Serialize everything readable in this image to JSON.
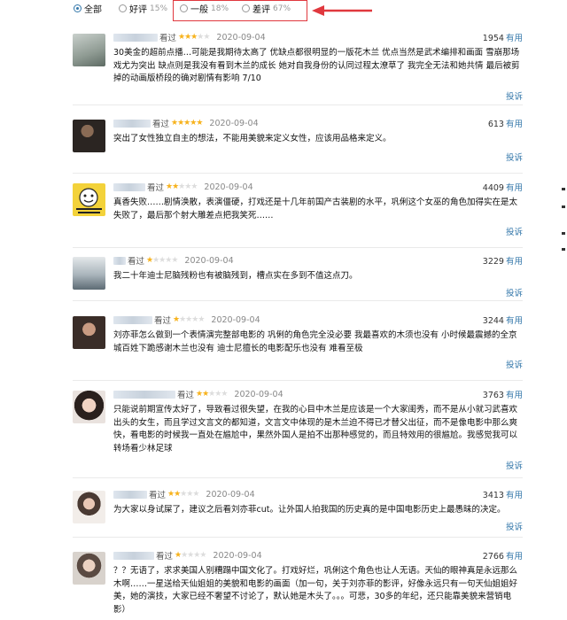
{
  "filters": {
    "options": [
      {
        "label": "全部",
        "pct": "",
        "selected": true
      },
      {
        "label": "好评",
        "pct": "15%",
        "selected": false
      },
      {
        "label": "一般",
        "pct": "18%",
        "selected": false
      },
      {
        "label": "差评",
        "pct": "67%",
        "selected": false
      }
    ],
    "highlight_color": "#e0383e"
  },
  "colors": {
    "accent": "#3377aa",
    "star": "#f7b21c"
  },
  "comments": [
    {
      "watched": "看过",
      "stars": 3,
      "date": "2020-09-04",
      "votes": "1954",
      "useful": "有用",
      "report": "投诉",
      "text": "30美金的超前点播…可能是我期待太高了 优缺点都很明显的一版花木兰 优点当然是武术编排和画面 雪崩那场戏尤为突出 缺点则是我没有看到木兰的成长 她对自我身份的认同过程太潦草了 我完全无法和她共情 最后被剪掉的动画版桥段的确对剧情有影响 7/10"
    },
    {
      "watched": "看过",
      "stars": 5,
      "date": "2020-09-04",
      "votes": "613",
      "useful": "有用",
      "report": "投诉",
      "text": "突出了女性独立自主的想法，不能用美貌来定义女性，应该用品格来定义。"
    },
    {
      "watched": "看过",
      "stars": 2,
      "date": "2020-09-04",
      "votes": "4409",
      "useful": "有用",
      "report": "投诉",
      "text": "真香失败……剧情涣散，表演僵硬，打戏还是十几年前国产古装剧的水平，巩俐这个女巫的角色加得实在是太失败了，最后那个射大雕差点把我笑死……"
    },
    {
      "watched": "看过",
      "stars": 1,
      "date": "2020-09-04",
      "votes": "3229",
      "useful": "有用",
      "report": "投诉",
      "text": "我二十年迪士尼脑残粉也有被脑残到，槽点实在多到不值这点刀。"
    },
    {
      "watched": "看过",
      "stars": 1,
      "date": "2020-09-04",
      "votes": "3244",
      "useful": "有用",
      "report": "投诉",
      "text": "刘亦菲怎么做到一个表情演完整部电影的 巩俐的角色完全没必要 我最喜欢的木须也没有 小时候最震撼的全京城百姓下跪感谢木兰也没有 迪士尼擅长的电影配乐也没有 难看至极"
    },
    {
      "watched": "看过",
      "stars": 2,
      "date": "2020-09-04",
      "votes": "3763",
      "useful": "有用",
      "report": "投诉",
      "text": "只能说前期宣传太好了，导致看过很失望，在我的心目中木兰是应该是一个大家闺秀，而不是从小就习武喜欢出头的女生，而且学过文言文的都知道，文言文中体现的是木兰迫不得已才替父出征，而不是像电影中那么爽快，看电影的时候我一直处在尴尬中，果然外国人是拍不出那种感觉的，而且特效用的很尴尬。我感觉我可以转场看少林足球"
    },
    {
      "watched": "看过",
      "stars": 2,
      "date": "2020-09-04",
      "votes": "3413",
      "useful": "有用",
      "report": "投诉",
      "text": "为大家以身试屎了，建议之后看刘亦菲cut。让外国人拍我国的历史真的是中国电影历史上最愚昧的决定。"
    },
    {
      "watched": "看过",
      "stars": 1,
      "date": "2020-09-04",
      "votes": "2766",
      "useful": "有用",
      "report": "投诉",
      "text": "？？无语了，求求美国人别糟蹋中国文化了。打戏好烂，巩俐这个角色也让人无语。天仙的眼神真是永远那么木啊……一星送给天仙姐姐的美貌和电影的画面（加一句，关于刘亦菲的影评，好像永远只有一句天仙姐姐好美，她的演技，大家已经不奢望不讨论了，默认她是木头了。。。可悲，30多的年纪，还只能靠美貌来营销电影）"
    }
  ]
}
